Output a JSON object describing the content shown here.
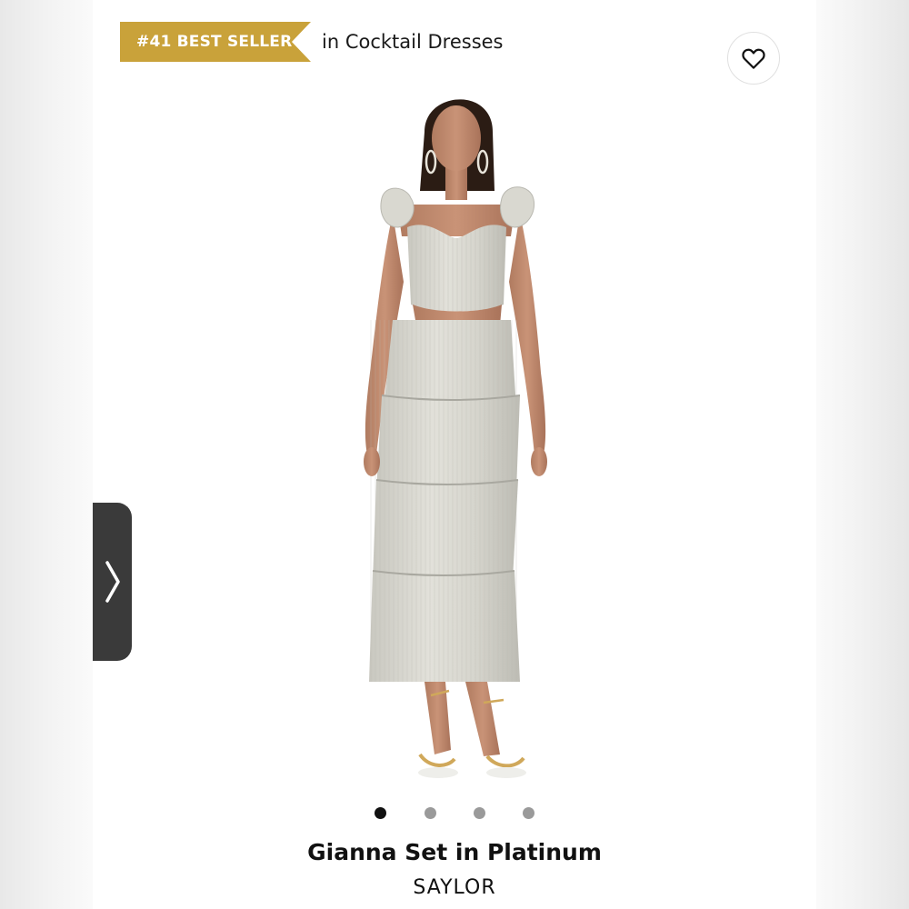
{
  "badge": {
    "label": "#41 BEST SELLER",
    "color": "#c9a23a"
  },
  "category": {
    "text": "in Cocktail Dresses"
  },
  "favorite": {
    "icon": "heart-outline-icon"
  },
  "carousel": {
    "next_icon": "chevron-right-icon",
    "slide_count": 4,
    "active_index": 0
  },
  "product": {
    "name": "Gianna Set in Platinum",
    "brand": "SAYLOR"
  }
}
